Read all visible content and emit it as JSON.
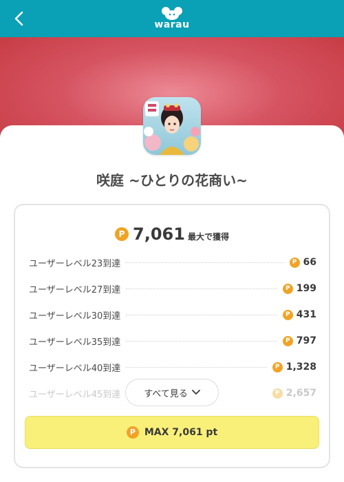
{
  "header": {
    "logo_text": "warau",
    "icons": {
      "back": "chevron-left-icon",
      "logo": "warau-mouse-logo-icon"
    }
  },
  "colors": {
    "header_bg": "#0aa0b5",
    "hero_red": "#d65462",
    "coin": "#f1a326",
    "max_button_bg": "#f9f07a"
  },
  "app": {
    "title": "咲庭 ~ひとりの花商い~",
    "icon": "game-app-icon"
  },
  "reward": {
    "coin_glyph": "P",
    "total": "7,061",
    "total_suffix": "最大で獲得"
  },
  "rows": [
    {
      "label": "ユーザーレベル23到達",
      "value": "66"
    },
    {
      "label": "ユーザーレベル27到達",
      "value": "199"
    },
    {
      "label": "ユーザーレベル30到達",
      "value": "431"
    },
    {
      "label": "ユーザーレベル35到達",
      "value": "797"
    },
    {
      "label": "ユーザーレベル40到達",
      "value": "1,328"
    },
    {
      "label": "ユーザーレベル45到達",
      "value": "2,657"
    }
  ],
  "see_all": {
    "label": "すべて見る",
    "icon": "chevron-down-icon"
  },
  "max_button": {
    "label": "MAX 7,061 pt"
  }
}
